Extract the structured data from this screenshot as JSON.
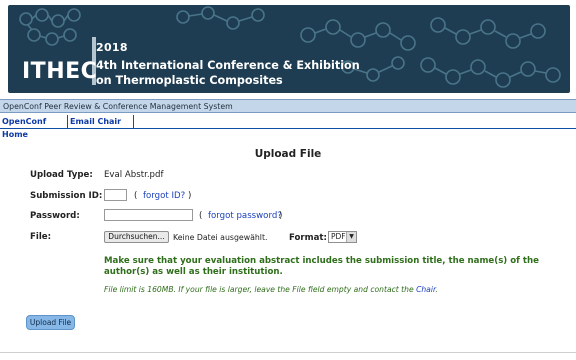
{
  "banner": {
    "year": "2018",
    "logo": "ITHEC",
    "conference_line1": "4th International Conference & Exhibition",
    "conference_line2": "on Thermoplastic Composites"
  },
  "system_bar": {
    "text": "OpenConf Peer Review & Conference Management System"
  },
  "nav": {
    "items": [
      {
        "label": "OpenConf Home"
      },
      {
        "label": "Email Chair"
      }
    ]
  },
  "form": {
    "title": "Upload File",
    "upload_type_label": "Upload Type:",
    "upload_type_value": "Eval Abstr.pdf",
    "submission_id_label": "Submission ID:",
    "submission_id_value": "",
    "forgot_id_prefix": "( ",
    "forgot_id_link": "forgot ID?",
    "forgot_id_suffix": " )",
    "password_label": "Password:",
    "password_value": "",
    "forgot_password_prefix": "( ",
    "forgot_password_link": "forgot password?",
    "forgot_password_suffix": " )",
    "file_label": "File:",
    "browse_button": "Durchsuchen...",
    "no_file_text": "Keine Datei ausgewählt.",
    "format_label": "Format:",
    "format_value": "PDF",
    "note": "Make sure that your evaluation abstract includes the submission title, the name(s) of the author(s) as well as their institution.",
    "limit_text_1": "File limit is 160MB. If your file is larger, leave the File field empty and contact the ",
    "limit_chair_link": "Chair",
    "limit_text_2": ".",
    "upload_button": "Upload File"
  },
  "colors": {
    "banner_bg": "#1f3d52",
    "system_bar_bg": "#c4d7ea",
    "nav_text": "#0d3aa8",
    "note_green": "#2f6e1b",
    "link_blue": "#1a3fbd",
    "upload_button_bg": "#86b7e7"
  },
  "icons": {
    "format_dropdown": "chevron-down-icon",
    "banner_decoration": "molecule-chain-icon"
  }
}
